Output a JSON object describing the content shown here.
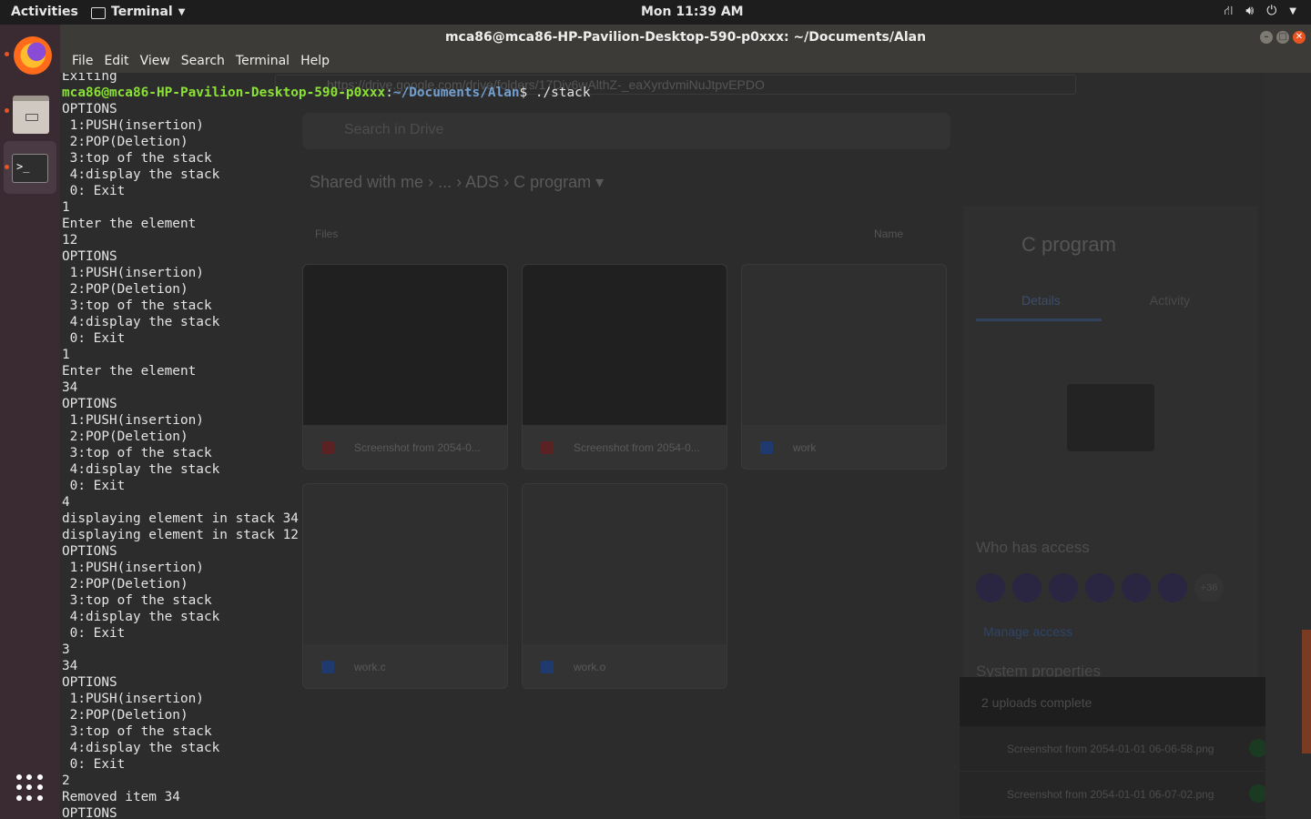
{
  "topbar": {
    "activities": "Activities",
    "app_menu": "Terminal",
    "clock": "Mon 11:39 AM",
    "tray_icons": [
      "network-icon",
      "volume-icon",
      "power-icon",
      "chevron-down-icon"
    ]
  },
  "dock": {
    "items": [
      "Firefox",
      "Files",
      "Terminal"
    ],
    "apps_label": "Show Applications"
  },
  "window": {
    "title": "mca86@mca86-HP-Pavilion-Desktop-590-p0xxx: ~/Documents/Alan",
    "menu": [
      "File",
      "Edit",
      "View",
      "Search",
      "Terminal",
      "Help"
    ]
  },
  "terminal": {
    "prompt_user": "mca86@mca86-HP-Pavilion-Desktop-590-p0xxx",
    "prompt_path": "~/Documents/Alan",
    "command": "./stack",
    "lines": [
      "Exiting",
      "@@PROMPT@@",
      "OPTIONS",
      " 1:PUSH(insertion)",
      " 2:POP(Deletion)",
      " 3:top of the stack",
      " 4:display the stack",
      " 0: Exit",
      "1",
      "Enter the element",
      "12",
      "OPTIONS",
      " 1:PUSH(insertion)",
      " 2:POP(Deletion)",
      " 3:top of the stack",
      " 4:display the stack",
      " 0: Exit",
      "1",
      "Enter the element",
      "34",
      "OPTIONS",
      " 1:PUSH(insertion)",
      " 2:POP(Deletion)",
      " 3:top of the stack",
      " 4:display the stack",
      " 0: Exit",
      "4",
      "displaying element in stack 34",
      "displaying element in stack 12",
      "OPTIONS",
      " 1:PUSH(insertion)",
      " 2:POP(Deletion)",
      " 3:top of the stack",
      " 4:display the stack",
      " 0: Exit",
      "3",
      "34",
      "OPTIONS",
      " 1:PUSH(insertion)",
      " 2:POP(Deletion)",
      " 3:top of the stack",
      " 4:display the stack",
      " 0: Exit",
      "2",
      "Removed item 34",
      "OPTIONS"
    ]
  },
  "background_drive": {
    "url": "https://drive.google.com/drive/folders/17Div6wAlthZ-_eaXyrdvmiNuJtpvEPDO",
    "search_placeholder": "Search in Drive",
    "breadcrumb": [
      "Shared with me",
      "...",
      "ADS",
      "C program"
    ],
    "files_header": "Files",
    "sort_label": "Name",
    "files": [
      "Screenshot from 2054-0...",
      "Screenshot from 2054-0...",
      "work",
      "work.c",
      "work.o"
    ],
    "details_title": "C program",
    "tabs": [
      "Details",
      "Activity"
    ],
    "who_has_access": "Who has access",
    "more_count": "+36",
    "manage_access": "Manage access",
    "system_properties": "System properties",
    "uploads_header": "2 uploads complete",
    "uploads": [
      "Screenshot from 2054-01-01 06-06-58.png",
      "Screenshot from 2054-01-01 06-07-02.png"
    ]
  }
}
